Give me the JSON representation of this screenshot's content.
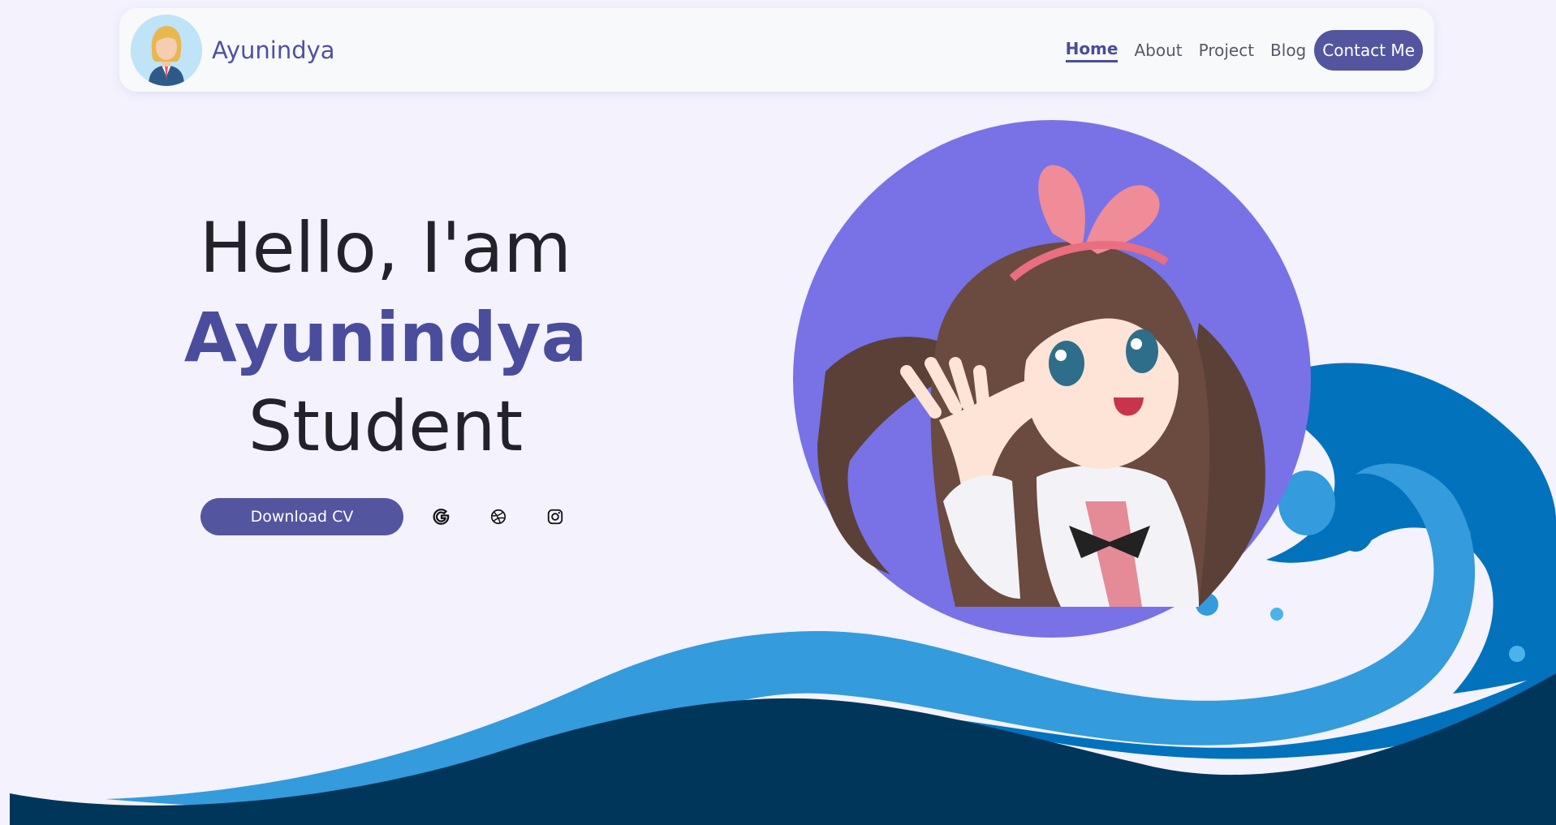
{
  "brand": {
    "name": "Ayunindya"
  },
  "nav": {
    "items": [
      {
        "label": "Home",
        "active": true
      },
      {
        "label": "About",
        "active": false
      },
      {
        "label": "Project",
        "active": false
      },
      {
        "label": "Blog",
        "active": false
      }
    ],
    "contact_label": "Contact Me"
  },
  "hero": {
    "greeting": "Hello, I'am",
    "name": "Ayunindya",
    "role": "Student",
    "cv_button": "Download CV"
  },
  "social": [
    {
      "icon": "google-icon"
    },
    {
      "icon": "dribbble-icon"
    },
    {
      "icon": "instagram-icon"
    }
  ],
  "colors": {
    "background": "#f3f2fd",
    "accent": "#53559f",
    "circle": "#7872e6",
    "wave_dark": "#00365a",
    "wave_mid": "#0272bd",
    "wave_light": "#349bdc"
  }
}
